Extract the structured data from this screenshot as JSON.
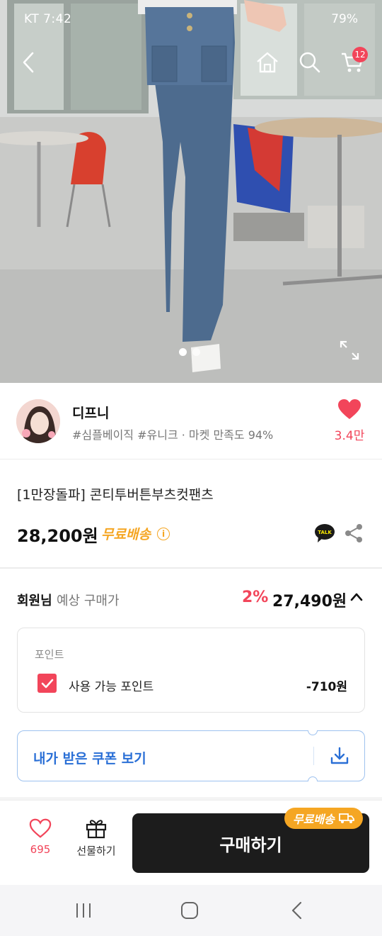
{
  "status_bar": {
    "carrier_time": "KT 7:42",
    "battery": "79%"
  },
  "header": {
    "cart_count": "12",
    "icons": [
      "back-icon",
      "home-icon",
      "search-icon",
      "cart-icon"
    ]
  },
  "gallery": {
    "page_count": 2,
    "current_page": 1
  },
  "seller": {
    "name": "디프니",
    "tags": "#심플베이직 #유니크 · 마켓 만족도 94%",
    "like_count": "3.4만"
  },
  "product": {
    "title": "[1만장돌파] 콘티투버튼부츠컷팬츠",
    "price": "28,200원",
    "shipping": "무료배송"
  },
  "member_price": {
    "label": "회원님",
    "sub_label": "예상 구매가",
    "discount_rate": "2%",
    "price": "27,490원"
  },
  "points": {
    "title": "포인트",
    "checkbox_label": "사용 가능 포인트",
    "value": "-710원",
    "checked": true
  },
  "coupon": {
    "label": "내가 받은 쿠폰 보기"
  },
  "bottom_bar": {
    "wish_count": "695",
    "gift_label": "선물하기",
    "buy_label": "구매하기",
    "ship_badge": "무료배송"
  },
  "colors": {
    "accent": "#f2455a",
    "shipping": "#f5a623",
    "coupon": "#2a6fd6",
    "buy_button": "#1c1c1c"
  }
}
